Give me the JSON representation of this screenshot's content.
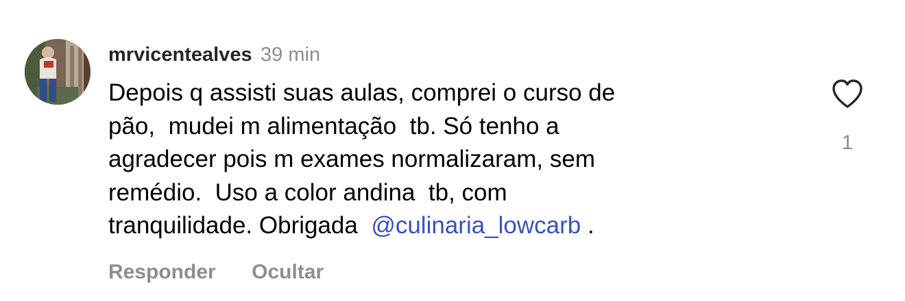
{
  "comment": {
    "username": "mrvicentealves",
    "timestamp": "39 min",
    "text_lines": [
      "Depois q assisti suas aulas, comprei o curso de",
      "pão,  mudei m alimentação  tb. Só tenho a",
      "agradecer pois m exames normalizaram, sem",
      "remédio.  Uso a color andina  tb, com"
    ],
    "last_line_prefix": "tranquilidade. Obrigada  ",
    "mention": "@culinaria_lowcarb",
    "last_line_suffix": " .",
    "like_count": "1",
    "actions": {
      "reply": "Responder",
      "hide": "Ocultar"
    }
  },
  "icons": {
    "like": "heart-outline-icon"
  },
  "colors": {
    "username": "#262626",
    "muted": "#8e8e8e",
    "mention": "#3850c4",
    "heart_stroke": "#262626"
  }
}
